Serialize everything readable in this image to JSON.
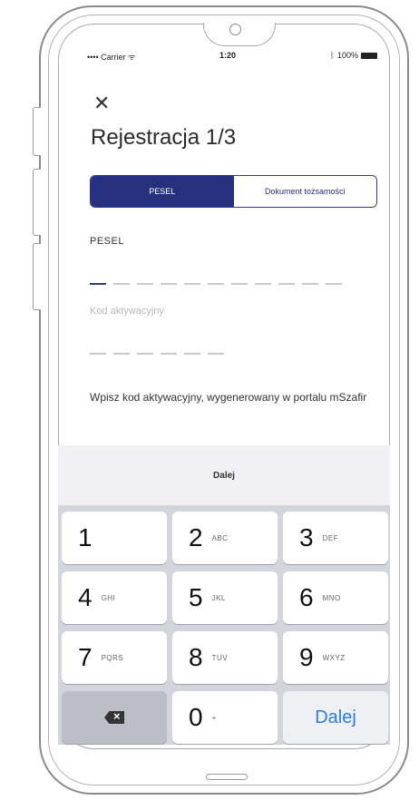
{
  "status_bar": {
    "carrier": "•••• Carrier ᯤ",
    "time": "1:20",
    "bluetooth_icon": "bluetooth-icon",
    "battery_text": "100%"
  },
  "header": {
    "close_icon": "close-icon",
    "title": "Rejestracja 1/3"
  },
  "segmented": {
    "tab_pesel": "PESEL",
    "tab_document": "Dokument tożsamości",
    "active": "PESEL"
  },
  "form": {
    "pesel_label": "PESEL",
    "pesel_digits": 11,
    "activation_label": "Kod aktywacyjny",
    "activation_digits": 6,
    "hint": "Wpisz kod aktywacyjny, wygenerowany w portalu mSzafir"
  },
  "keyboard": {
    "toolbar_label": "Dalej",
    "keys": [
      {
        "digit": "1",
        "letters": ""
      },
      {
        "digit": "2",
        "letters": "ABC"
      },
      {
        "digit": "3",
        "letters": "DEF"
      },
      {
        "digit": "4",
        "letters": "GHI"
      },
      {
        "digit": "5",
        "letters": "JKL"
      },
      {
        "digit": "6",
        "letters": "MNO"
      },
      {
        "digit": "7",
        "letters": "PQRS"
      },
      {
        "digit": "8",
        "letters": "TUV"
      },
      {
        "digit": "9",
        "letters": "WXYZ"
      }
    ],
    "zero": {
      "digit": "0",
      "letters": "+"
    },
    "done_label": "Dalej",
    "backspace_icon": "backspace-icon"
  },
  "colors": {
    "accent": "#25307f",
    "done_blue": "#2e7ae6",
    "keyboard_bg": "#d2d5dc"
  }
}
